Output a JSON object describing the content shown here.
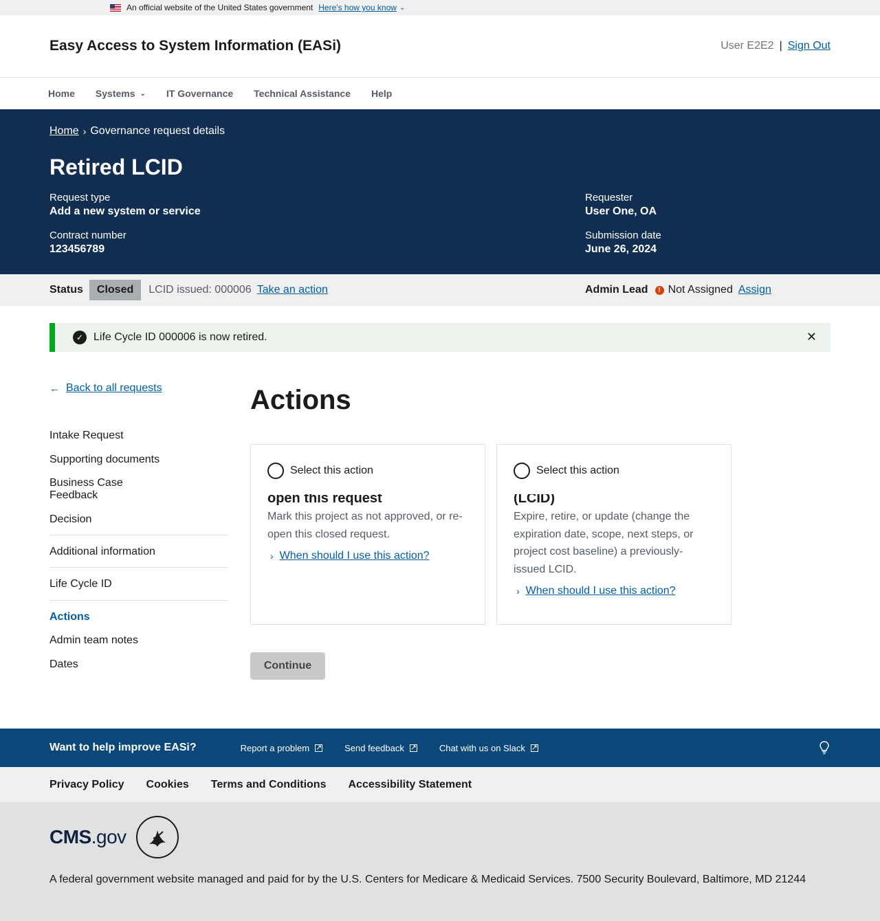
{
  "gov_banner": {
    "text": "An official website of the United States government",
    "link": "Here's how you know"
  },
  "header": {
    "title": "Easy Access to System Information (EASi)",
    "user": "User E2E2",
    "separator": "|",
    "sign_out": "Sign Out"
  },
  "nav": {
    "items": [
      "Home",
      "Systems",
      "IT Governance",
      "Technical Assistance",
      "Help"
    ]
  },
  "hero": {
    "breadcrumb_home": "Home",
    "breadcrumb_current": "Governance request details",
    "title": "Retired LCID",
    "request_type_label": "Request type",
    "request_type_value": "Add a new system or service",
    "contract_label": "Contract number",
    "contract_value": "123456789",
    "requester_label": "Requester",
    "requester_value": "User One, OA",
    "submission_label": "Submission date",
    "submission_value": "June 26, 2024"
  },
  "status_bar": {
    "status_label": "Status",
    "status_value": "Closed",
    "lcid_issued": "LCID issued: 000006",
    "take_action": "Take an action",
    "admin_lead_label": "Admin Lead",
    "admin_lead_value": "Not Assigned",
    "assign": "Assign"
  },
  "alert": {
    "message": "Life Cycle ID 000006 is now retired."
  },
  "sidebar": {
    "back": "Back to all requests",
    "items": [
      "Intake Request",
      "Supporting documents",
      "Business Case",
      "Feedback",
      "Decision",
      "Additional information",
      "Life Cycle ID",
      "Actions",
      "Admin team notes",
      "Dates"
    ]
  },
  "main": {
    "title": "Actions",
    "cards": [
      {
        "radio_label": "Select this action",
        "title": "open this request",
        "description": "Mark this project as not approved, or re-open this closed request.",
        "help": "When should I use this action?"
      },
      {
        "radio_label": "Select this action",
        "title": "(LCID)",
        "description": "Expire, retire, or update (change the expiration date, scope, next steps, or project cost baseline) a previously-issued LCID.",
        "help": "When should I use this action?"
      }
    ],
    "continue": "Continue"
  },
  "feedback_band": {
    "title": "Want to help improve EASi?",
    "links": [
      "Report a problem",
      "Send feedback",
      "Chat with us on Slack"
    ]
  },
  "footer_links": [
    "Privacy Policy",
    "Cookies",
    "Terms and Conditions",
    "Accessibility Statement"
  ],
  "footer": {
    "logo_cms": "CMS",
    "logo_gov": ".gov",
    "text": "A federal government website managed and paid for by the U.S. Centers for Medicare & Medicaid Services. 7500 Security Boulevard, Baltimore, MD 21244"
  },
  "colors": {
    "hero_bg": "#112e51",
    "link": "#005ea2",
    "feedback_bg": "#0b4778",
    "alert_accent": "#00a91c",
    "warning": "#d54309"
  }
}
